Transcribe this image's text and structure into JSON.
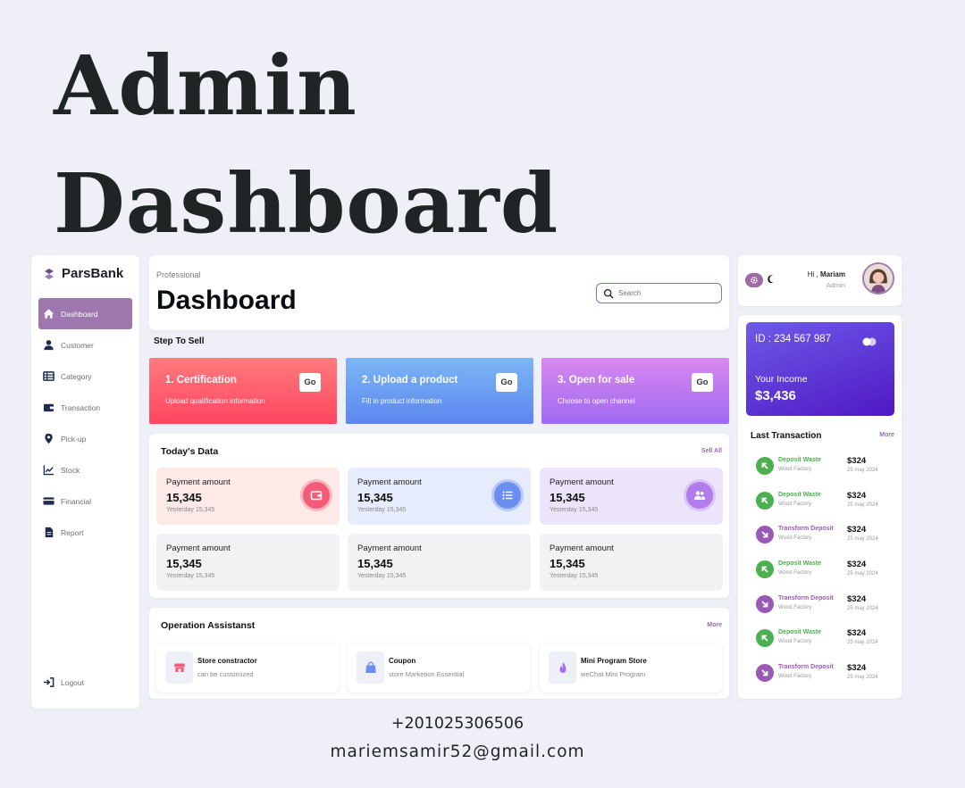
{
  "hero": {
    "line1": "Admin",
    "line2": "Dashboard"
  },
  "brand": {
    "name": "ParsBank"
  },
  "sidebar": {
    "items": [
      {
        "label": "Dashboard",
        "icon": "home-icon"
      },
      {
        "label": "Customer",
        "icon": "user-icon"
      },
      {
        "label": "Category",
        "icon": "table-icon"
      },
      {
        "label": "Transaction",
        "icon": "wallet-icon"
      },
      {
        "label": "Pick-up",
        "icon": "map-pin-icon"
      },
      {
        "label": "Stock",
        "icon": "chart-line-icon"
      },
      {
        "label": "Financial",
        "icon": "credit-card-icon"
      },
      {
        "label": "Report",
        "icon": "document-icon"
      }
    ],
    "logout": "Logout"
  },
  "header": {
    "breadcrumb": "Professional",
    "title": "Dashboard",
    "search_placeholder": "Search"
  },
  "steps": {
    "label": "Step To Sell",
    "items": [
      {
        "title": "1. Certification",
        "sub": "Upload qualification information",
        "button": "Go"
      },
      {
        "title": "2. Upload a product",
        "sub": "Fill in product information",
        "button": "Go"
      },
      {
        "title": "3. Open for sale",
        "sub": "Choose to open channel",
        "button": "Go"
      }
    ]
  },
  "today": {
    "title": "Today's Data",
    "link": "Sell All",
    "tiles": [
      {
        "label": "Payment amount",
        "value": "15,345",
        "sub": "Yesterday 15,345"
      },
      {
        "label": "Payment amount",
        "value": "15,345",
        "sub": "Yesterday 15,345"
      },
      {
        "label": "Payment amount",
        "value": "15,345",
        "sub": "Yesterday 15,345"
      },
      {
        "label": "Payment amount",
        "value": "15,345",
        "sub": "Yesterday 15,345"
      },
      {
        "label": "Payment amount",
        "value": "15,345",
        "sub": "Yesterday 15,345"
      },
      {
        "label": "Payment amount",
        "value": "15,345",
        "sub": "Yesterday 15,345"
      }
    ]
  },
  "operation": {
    "title": "Operation Assistanst",
    "link": "More",
    "items": [
      {
        "title": "Store constractor",
        "sub": "can be customized",
        "icon": "store-icon"
      },
      {
        "title": "Coupon",
        "sub": "store Marketion Essential",
        "icon": "bag-icon"
      },
      {
        "title": "Mini Program Store",
        "sub": "weChat Mini Program",
        "icon": "flame-icon"
      }
    ]
  },
  "user": {
    "greeting": "Hi ,",
    "name": "Mariam",
    "role": "Admin"
  },
  "bank_card": {
    "id": "ID : 234 567 987",
    "income_label": "Your Income",
    "income_value": "$3,436"
  },
  "transactions": {
    "title": "Last Transaction",
    "link": "More",
    "items": [
      {
        "type": "deposit",
        "title": "Deposit Waste",
        "sub": "Wood Factory",
        "amount": "$324",
        "date": "25 may 2024"
      },
      {
        "type": "deposit",
        "title": "Deposit Waste",
        "sub": "Wood Factory",
        "amount": "$324",
        "date": "25 may 2024"
      },
      {
        "type": "transform",
        "title": "Transform Deposit",
        "sub": "Wood Factory",
        "amount": "$324",
        "date": "25 may 2024"
      },
      {
        "type": "deposit",
        "title": "Deposit Waste",
        "sub": "Wood Factory",
        "amount": "$324",
        "date": "25 may 2024"
      },
      {
        "type": "transform",
        "title": "Transform Deposit",
        "sub": "Wood Factory",
        "amount": "$324",
        "date": "25 may 2024"
      },
      {
        "type": "deposit",
        "title": "Deposit Waste",
        "sub": "Wood Factory",
        "amount": "$324",
        "date": "25 may 2024"
      },
      {
        "type": "transform",
        "title": "Transform Deposit",
        "sub": "Wood Factory",
        "amount": "$324",
        "date": "25 may 2024"
      }
    ]
  },
  "contact": {
    "phone": "+201025306506",
    "email": "mariemsamir52@gmail.com"
  },
  "colors": {
    "accent": "#9e77ae",
    "deposit_green": "#4caf50",
    "transform_purple": "#9b59b6",
    "card_indigo": "#5b2ed4"
  }
}
